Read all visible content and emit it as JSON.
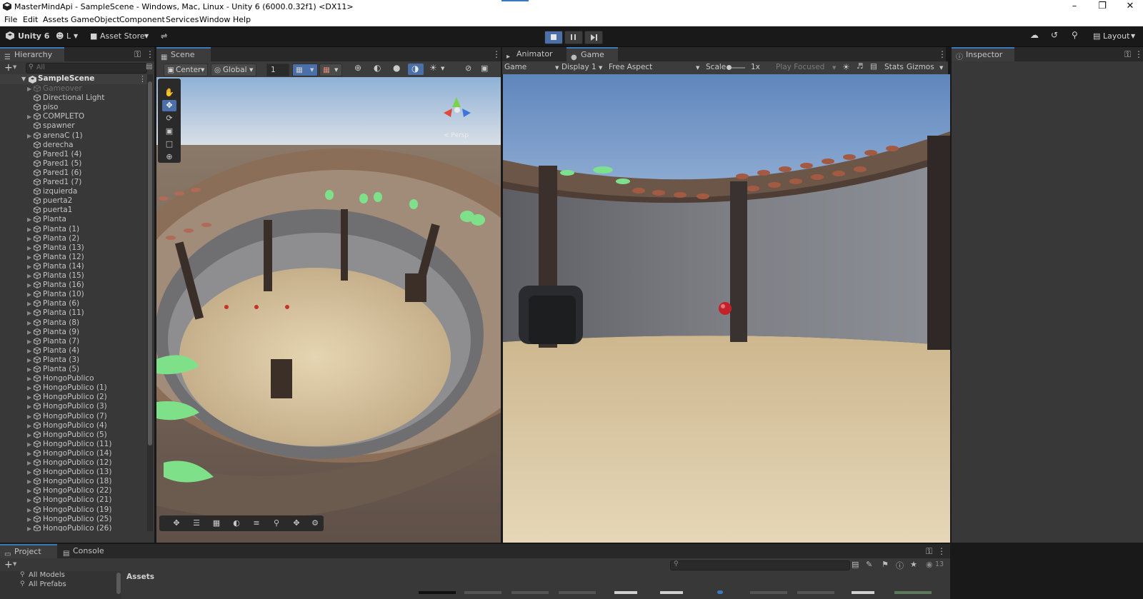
{
  "titlebar": {
    "title": "MasterMindApi - SampleScene - Windows, Mac, Linux - Unity 6 (6000.0.32f1) <DX11>"
  },
  "menu": [
    "File",
    "Edit",
    "Assets",
    "GameObject",
    "Component",
    "Services",
    "Window",
    "Help"
  ],
  "toolbar": {
    "account": "Unity 6",
    "user": "L",
    "asset_store": "Asset Store",
    "layout": "Layout"
  },
  "hierarchy": {
    "tab": "Hierarchy",
    "search_placeholder": "All",
    "scene": "SampleScene",
    "items": [
      {
        "name": "Gameover",
        "expandable": true,
        "dim": true
      },
      {
        "name": "Directional Light",
        "expandable": false
      },
      {
        "name": "piso",
        "expandable": false
      },
      {
        "name": "COMPLETO",
        "expandable": true
      },
      {
        "name": "spawner",
        "expandable": false
      },
      {
        "name": "arenaC (1)",
        "expandable": true
      },
      {
        "name": "derecha",
        "expandable": false
      },
      {
        "name": "Pared1 (4)",
        "expandable": false
      },
      {
        "name": "Pared1 (5)",
        "expandable": false
      },
      {
        "name": "Pared1 (6)",
        "expandable": false
      },
      {
        "name": "Pared1 (7)",
        "expandable": false
      },
      {
        "name": "izquierda",
        "expandable": false
      },
      {
        "name": "puerta2",
        "expandable": false
      },
      {
        "name": "puerta1",
        "expandable": false
      },
      {
        "name": "Planta",
        "expandable": true
      },
      {
        "name": "Planta (1)",
        "expandable": true
      },
      {
        "name": "Planta (2)",
        "expandable": true
      },
      {
        "name": "Planta (13)",
        "expandable": true
      },
      {
        "name": "Planta (12)",
        "expandable": true
      },
      {
        "name": "Planta (14)",
        "expandable": true
      },
      {
        "name": "Planta (15)",
        "expandable": true
      },
      {
        "name": "Planta (16)",
        "expandable": true
      },
      {
        "name": "Planta (10)",
        "expandable": true
      },
      {
        "name": "Planta (6)",
        "expandable": true
      },
      {
        "name": "Planta (11)",
        "expandable": true
      },
      {
        "name": "Planta (8)",
        "expandable": true
      },
      {
        "name": "Planta (9)",
        "expandable": true
      },
      {
        "name": "Planta (7)",
        "expandable": true
      },
      {
        "name": "Planta (4)",
        "expandable": true
      },
      {
        "name": "Planta (3)",
        "expandable": true
      },
      {
        "name": "Planta (5)",
        "expandable": true
      },
      {
        "name": "HongoPublico",
        "expandable": true
      },
      {
        "name": "HongoPublico (1)",
        "expandable": true
      },
      {
        "name": "HongoPublico (2)",
        "expandable": true
      },
      {
        "name": "HongoPublico (3)",
        "expandable": true
      },
      {
        "name": "HongoPublico (7)",
        "expandable": true
      },
      {
        "name": "HongoPublico (4)",
        "expandable": true
      },
      {
        "name": "HongoPublico (5)",
        "expandable": true
      },
      {
        "name": "HongoPublico (11)",
        "expandable": true
      },
      {
        "name": "HongoPublico (14)",
        "expandable": true
      },
      {
        "name": "HongoPublico (12)",
        "expandable": true
      },
      {
        "name": "HongoPublico (13)",
        "expandable": true
      },
      {
        "name": "HongoPublico (18)",
        "expandable": true
      },
      {
        "name": "HongoPublico (22)",
        "expandable": true
      },
      {
        "name": "HongoPublico (21)",
        "expandable": true
      },
      {
        "name": "HongoPublico (19)",
        "expandable": true
      },
      {
        "name": "HongoPublico (25)",
        "expandable": true
      },
      {
        "name": "HongoPublico (26)",
        "expandable": true
      }
    ]
  },
  "scene": {
    "tab": "Scene",
    "pivot": "Center",
    "space": "Global",
    "grid_value": "1",
    "persp_label": "< Persp"
  },
  "game": {
    "tabs": [
      "Animator",
      "Game"
    ],
    "view_mode": "Game",
    "display": "Display 1",
    "aspect": "Free Aspect",
    "scale_label": "Scale",
    "scale_value": "1x",
    "play_mode": "Play Focused",
    "stats": "Stats",
    "gizmos": "Gizmos"
  },
  "inspector": {
    "tab": "Inspector"
  },
  "bottom": {
    "tabs": [
      "Project",
      "Console"
    ],
    "favorites": [
      "All Models",
      "All Prefabs"
    ],
    "assets_header": "Assets",
    "hidden_count": "13"
  },
  "colors": {
    "accent": "#3a79bb",
    "panel": "#383838",
    "dark": "#191919",
    "sky_top": "#6f94c6",
    "sand": "#d8c6a0"
  }
}
